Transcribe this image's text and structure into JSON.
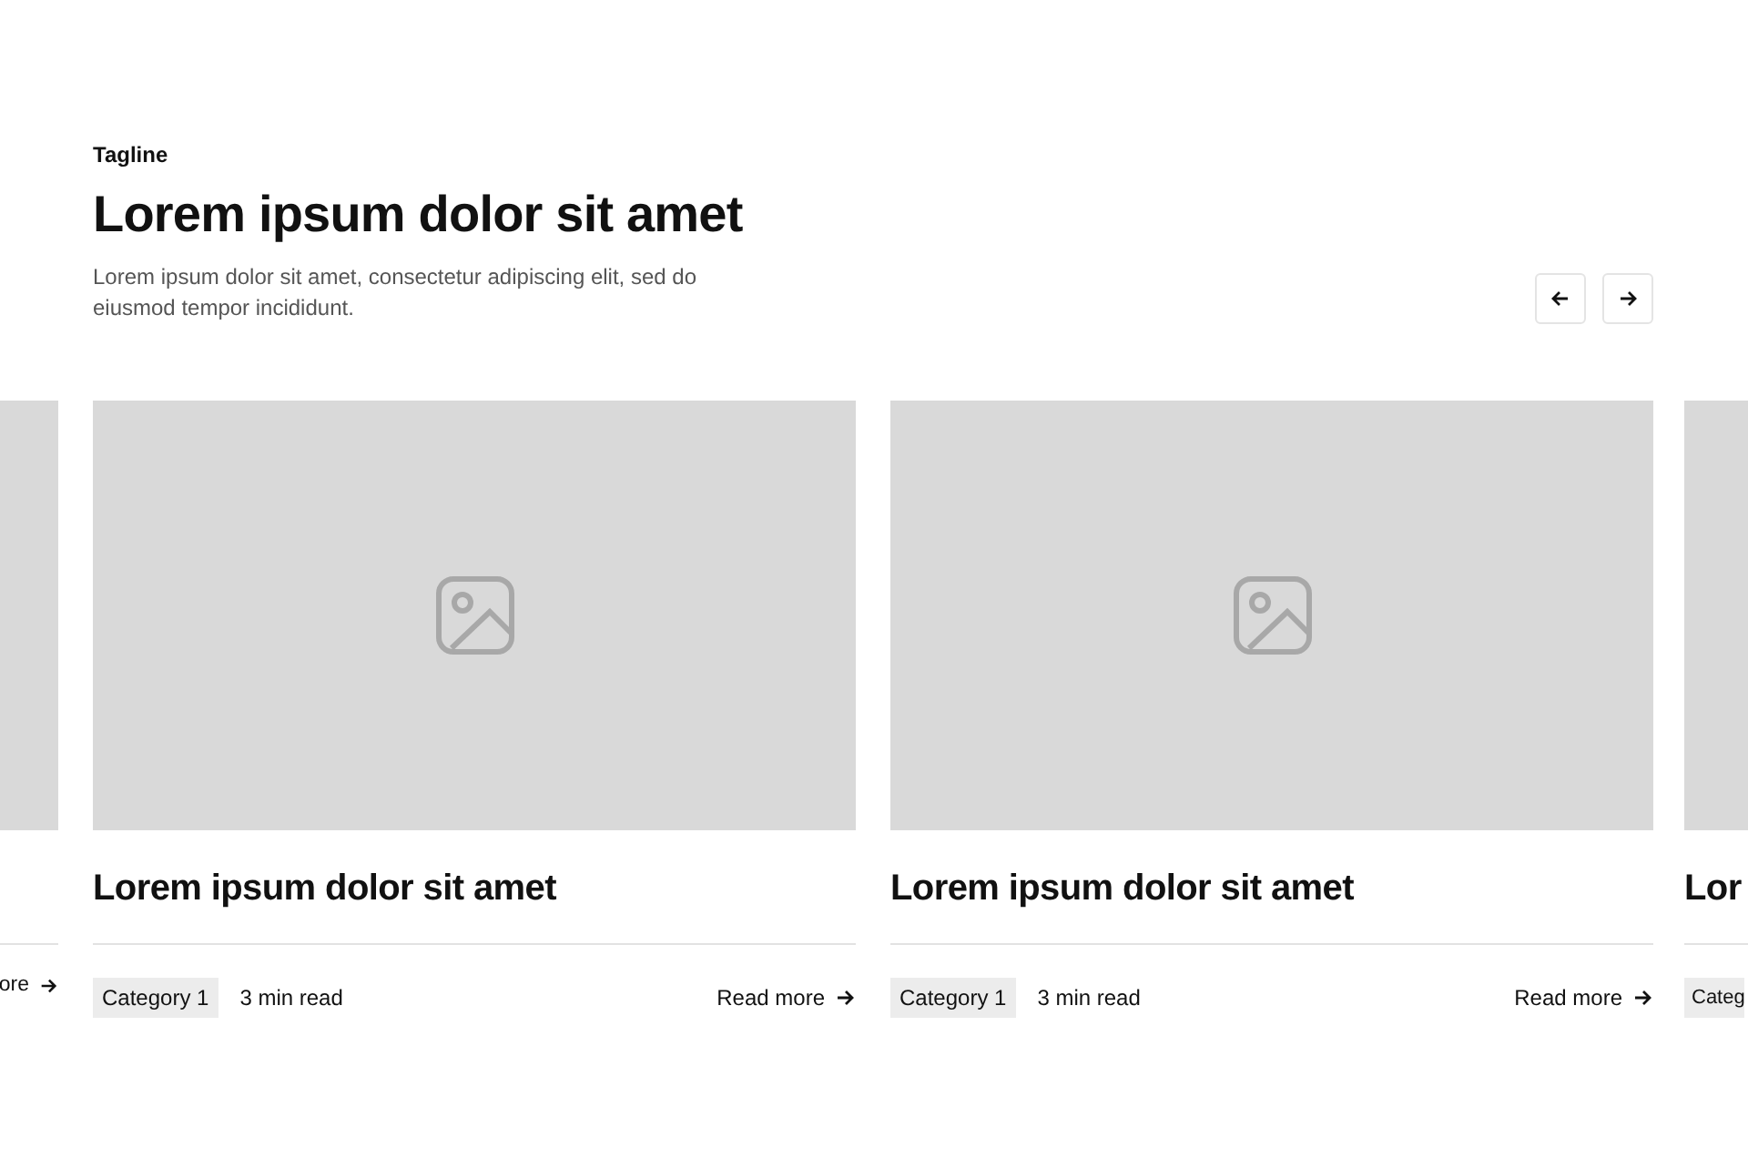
{
  "header": {
    "tagline": "Tagline",
    "heading": "Lorem ipsum dolor sit amet",
    "description": "Lorem ipsum dolor sit amet, consectetur adipiscing elit, sed do eiusmod tempor incididunt."
  },
  "nav": [
    {
      "kind": "prev"
    },
    {
      "kind": "next"
    }
  ],
  "cards": [
    {
      "kind": "partial-left",
      "read_more": "ore"
    },
    {
      "kind": "full",
      "title": "Lorem ipsum dolor sit amet",
      "category": "Category 1",
      "read_time": "3 min read",
      "read_more": "Read more"
    },
    {
      "kind": "full",
      "title": "Lorem ipsum dolor sit amet",
      "category": "Category 1",
      "read_time": "3 min read",
      "read_more": "Read more"
    },
    {
      "kind": "partial-right",
      "title": "Lor",
      "category": "Categ"
    }
  ]
}
